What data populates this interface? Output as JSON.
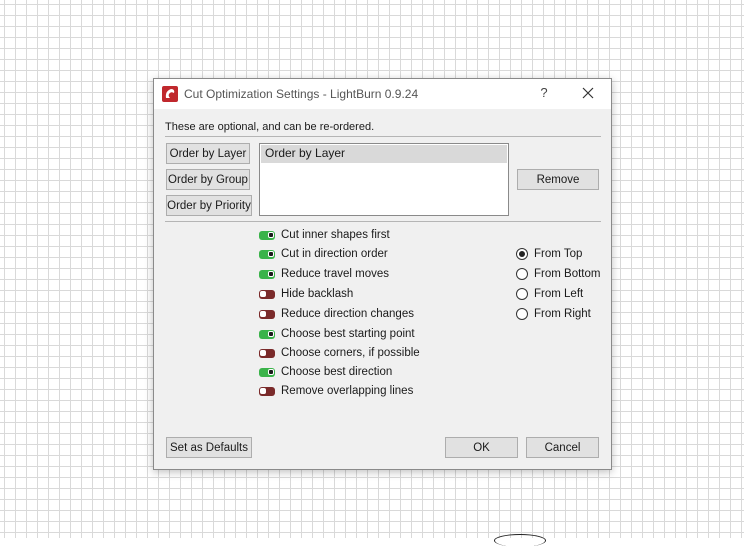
{
  "dialog": {
    "title": "Cut Optimization Settings - LightBurn 0.9.24",
    "help_label": "?",
    "intro": "These are optional, and can be re-ordered."
  },
  "order_buttons": {
    "by_layer": "Order by Layer",
    "by_group": "Order by Group",
    "by_priority": "Order by Priority"
  },
  "order_list": [
    "Order by Layer"
  ],
  "remove_label": "Remove",
  "options": [
    {
      "label": "Cut inner shapes first",
      "enabled": true
    },
    {
      "label": "Cut in direction order",
      "enabled": true
    },
    {
      "label": "Reduce travel moves",
      "enabled": true
    },
    {
      "label": "Hide backlash",
      "enabled": false
    },
    {
      "label": "Reduce direction changes",
      "enabled": false
    },
    {
      "label": "Choose best starting point",
      "enabled": true
    },
    {
      "label": "Choose corners, if possible",
      "enabled": false
    },
    {
      "label": "Choose best direction",
      "enabled": true
    },
    {
      "label": "Remove overlapping lines",
      "enabled": false
    }
  ],
  "direction": {
    "options": [
      "From Top",
      "From Bottom",
      "From Left",
      "From Right"
    ],
    "selected": "From Top"
  },
  "footer": {
    "defaults_label": "Set as Defaults",
    "ok_label": "OK",
    "cancel_label": "Cancel"
  },
  "colors": {
    "toggle_on": "#3bb34a",
    "toggle_off": "#7a2a2a",
    "app_icon": "#c0282d"
  }
}
